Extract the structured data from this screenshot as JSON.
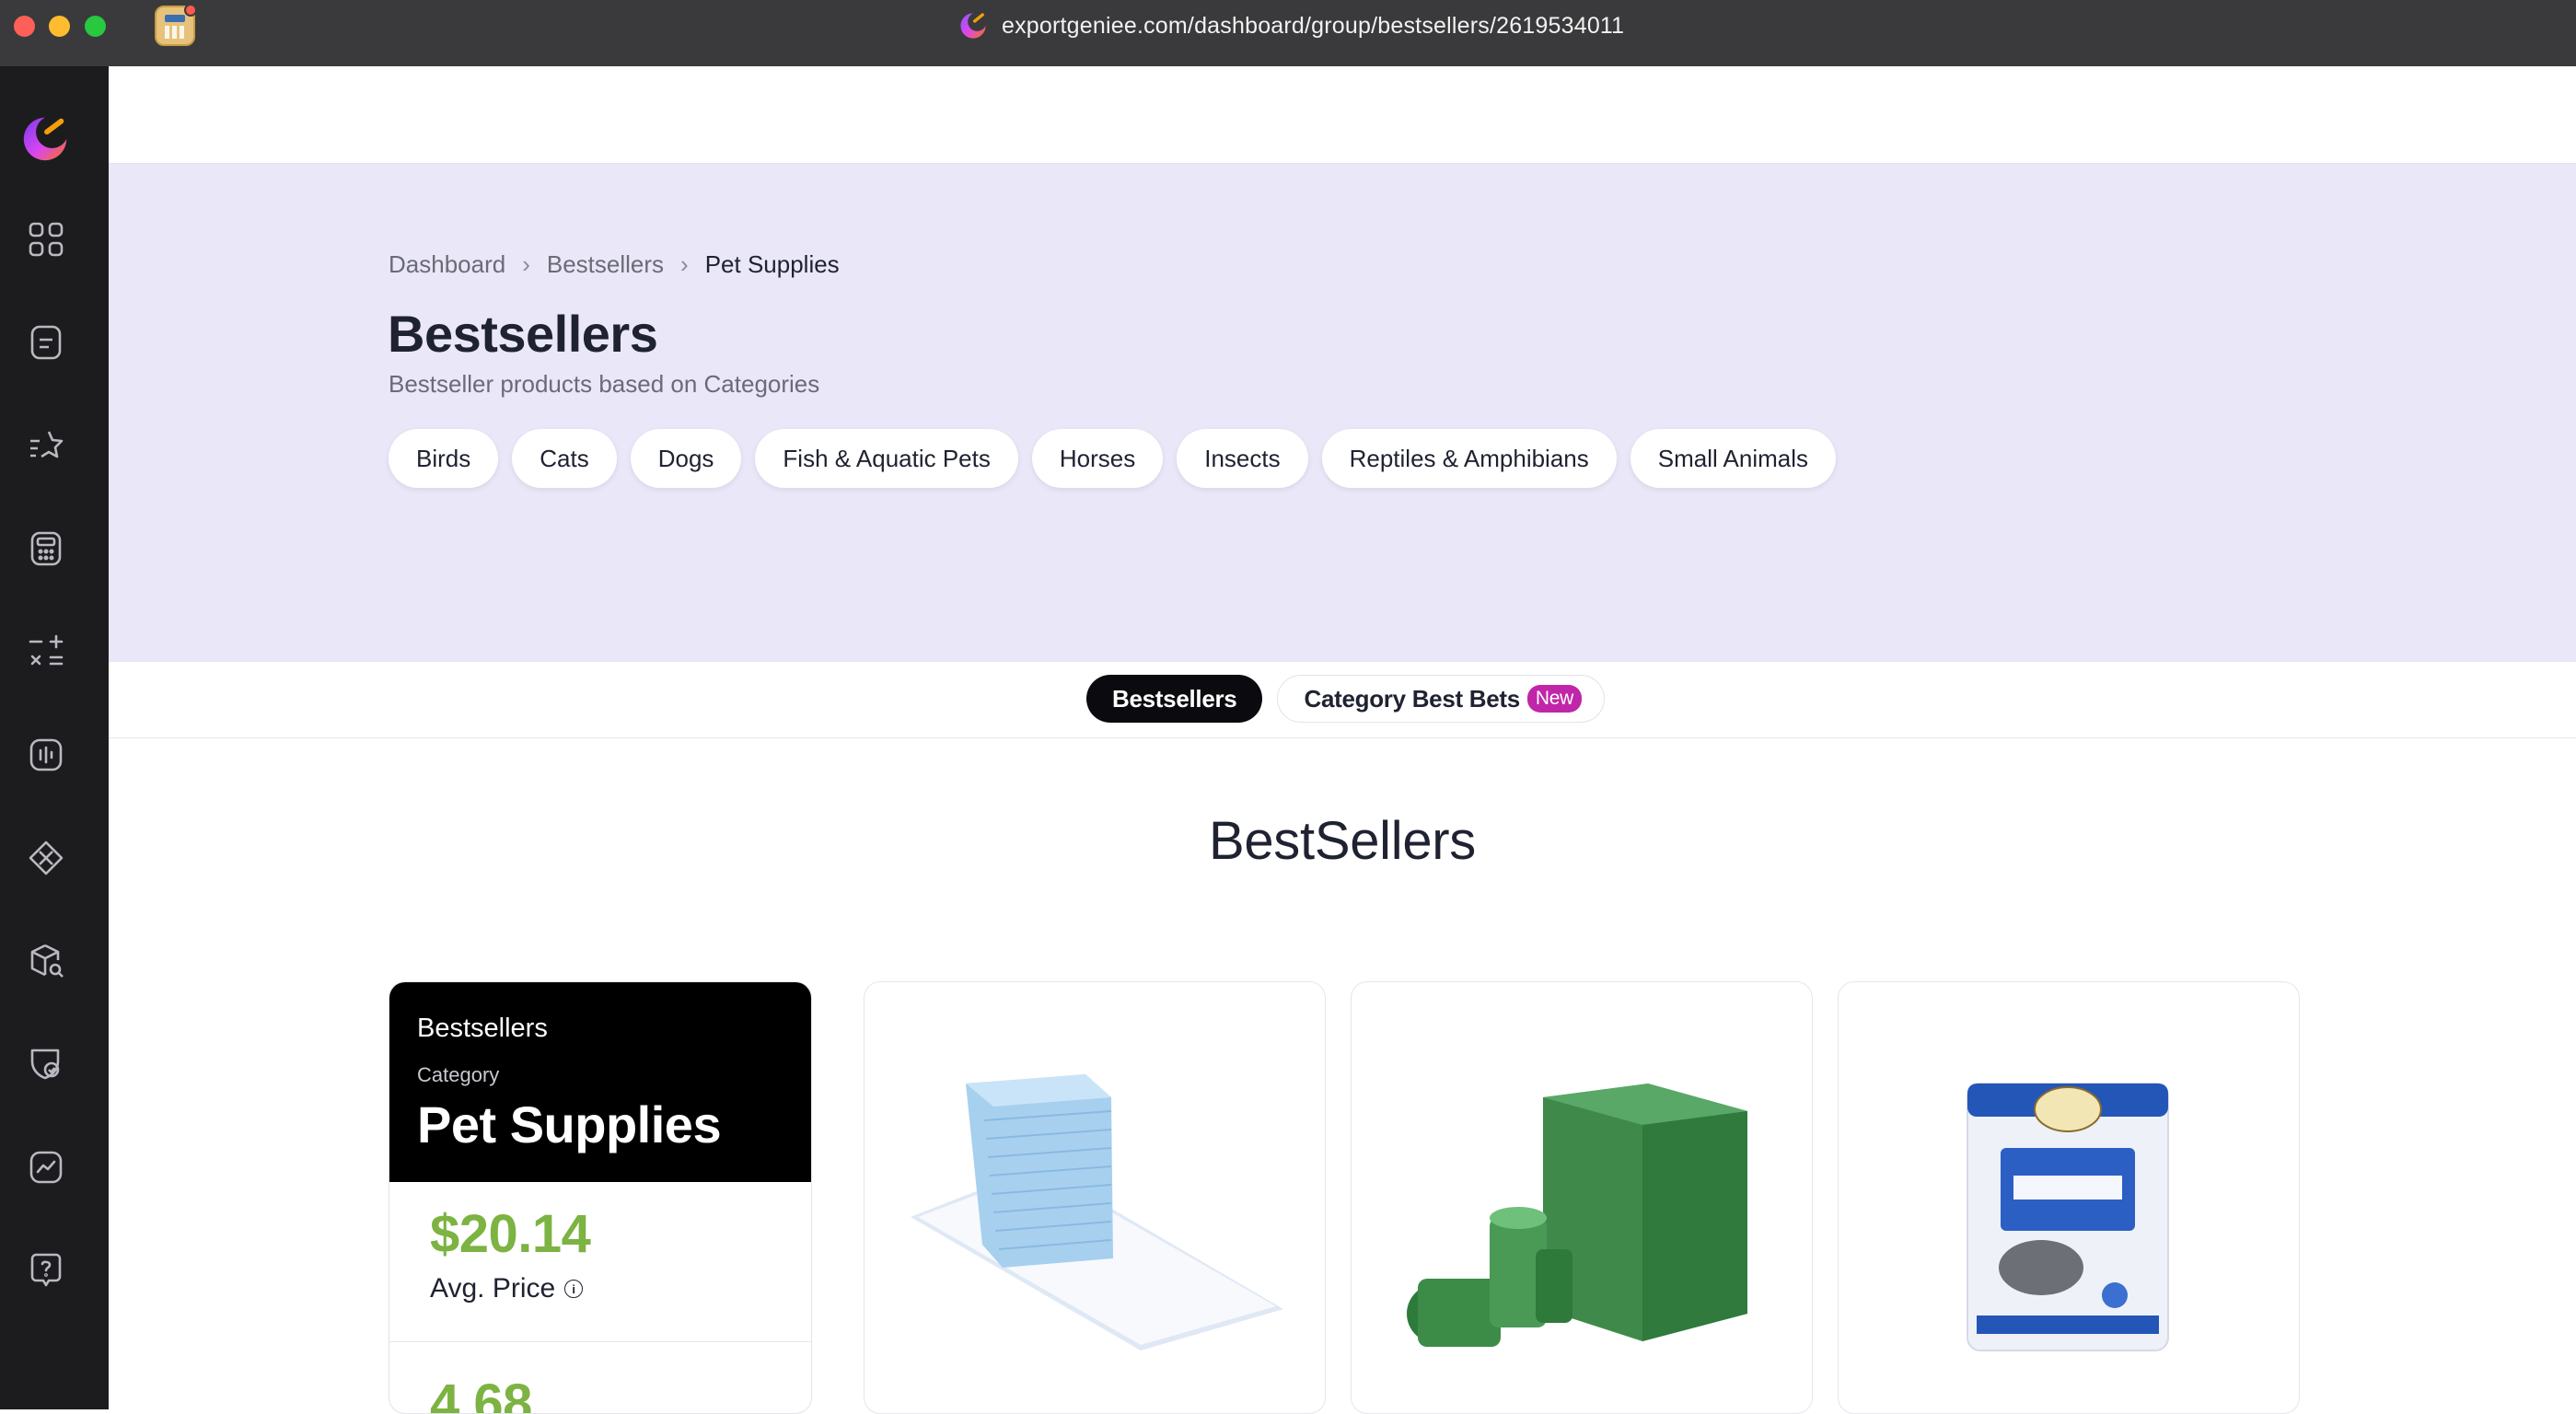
{
  "browser": {
    "url": "exportgeniee.com/dashboard/group/bestsellers/2619534011"
  },
  "sidebar": {
    "items": [
      {
        "icon": "grid-icon"
      },
      {
        "icon": "document-icon"
      },
      {
        "icon": "star-icon"
      },
      {
        "icon": "calculator-icon"
      },
      {
        "icon": "operations-icon"
      },
      {
        "icon": "chart-bars-icon"
      },
      {
        "icon": "diamond-icon"
      },
      {
        "icon": "box-search-icon"
      },
      {
        "icon": "shield-check-icon"
      },
      {
        "icon": "trend-icon"
      },
      {
        "icon": "help-icon"
      }
    ]
  },
  "breadcrumb": {
    "items": [
      "Dashboard",
      "Bestsellers"
    ],
    "current": "Pet Supplies"
  },
  "header": {
    "title": "Bestsellers",
    "subtitle": "Bestseller products based on Categories"
  },
  "categories": [
    "Birds",
    "Cats",
    "Dogs",
    "Fish & Aquatic Pets",
    "Horses",
    "Insects",
    "Reptiles & Amphibians",
    "Small Animals"
  ],
  "tabs": {
    "active": "Bestsellers",
    "other": "Category Best Bets",
    "badge": "New"
  },
  "section": {
    "title": "BestSellers"
  },
  "summary": {
    "label": "Bestsellers",
    "category_label": "Category",
    "category": "Pet Supplies",
    "price_value": "$20.14",
    "price_label": "Avg. Price",
    "rating_value": "4.68"
  },
  "colors": {
    "accent_green": "#7cb342",
    "badge_magenta": "#c026a8",
    "hero_bg": "#e9e7f8"
  }
}
